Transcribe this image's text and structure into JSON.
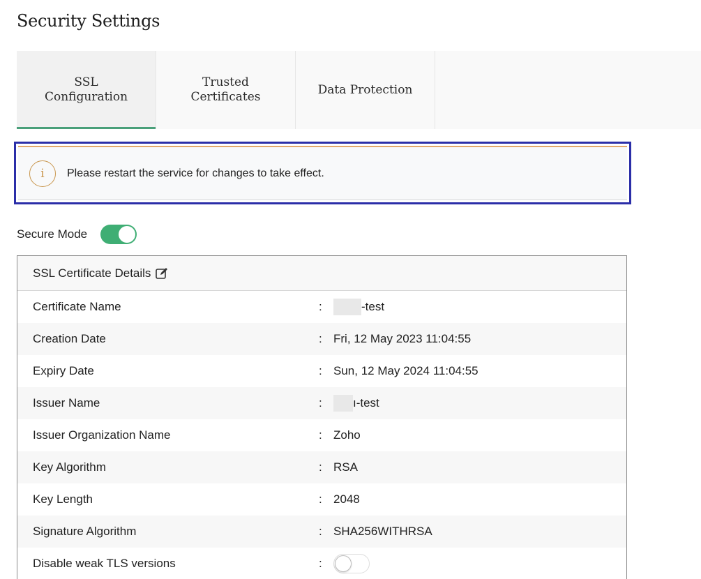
{
  "page": {
    "title": "Security Settings"
  },
  "tabs": [
    {
      "label": "SSL\nConfiguration",
      "active": true
    },
    {
      "label": "Trusted\nCertificates",
      "active": false
    },
    {
      "label": "Data Protection",
      "active": false
    }
  ],
  "notice": {
    "icon": "info-icon",
    "text": "Please restart the service for changes to take effect."
  },
  "secure_mode": {
    "label": "Secure Mode",
    "enabled": true
  },
  "certificate": {
    "title": "SSL Certificate Details",
    "edit_icon": "edit-icon",
    "separator": ":",
    "rows": [
      {
        "label": "Certificate Name",
        "value": "-test",
        "redacted": true
      },
      {
        "label": "Creation Date",
        "value": "Fri, 12 May 2023 11:04:55"
      },
      {
        "label": "Expiry Date",
        "value": "Sun, 12 May 2024 11:04:55"
      },
      {
        "label": "Issuer Name",
        "value": "ı-test",
        "redacted": true
      },
      {
        "label": "Issuer Organization Name",
        "value": "Zoho"
      },
      {
        "label": "Key Algorithm",
        "value": "RSA"
      },
      {
        "label": "Key Length",
        "value": "2048"
      },
      {
        "label": "Signature Algorithm",
        "value": "SHA256WITHRSA"
      },
      {
        "label": "Disable weak TLS versions",
        "toggle": false
      }
    ]
  },
  "colors": {
    "accent": "#4aa07a",
    "toggle_on": "#3fae74",
    "notice_border": "#2b2ea8",
    "info": "#c9974e"
  }
}
